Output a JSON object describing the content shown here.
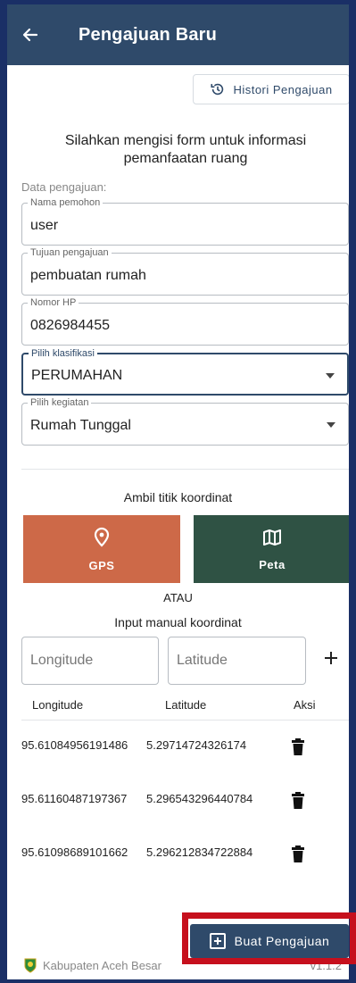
{
  "appbar": {
    "title": "Pengajuan Baru"
  },
  "histori_button": {
    "label": "Histori Pengajuan"
  },
  "intro": "Silahkan mengisi form untuk informasi pemanfaatan ruang",
  "section_label": "Data pengajuan:",
  "fields": [
    {
      "label": "Nama pemohon",
      "value": "user"
    },
    {
      "label": "Tujuan pengajuan",
      "value": "pembuatan rumah"
    },
    {
      "label": "Nomor HP",
      "value": "0826984455"
    },
    {
      "label": "Pilih klasifikasi",
      "value": "PERUMAHAN"
    },
    {
      "label": "Pilih kegiatan",
      "value": "Rumah Tunggal"
    }
  ],
  "coord": {
    "title": "Ambil titik koordinat",
    "gps_label": "GPS",
    "peta_label": "Peta",
    "atau": "ATAU",
    "manual_label": "Input manual koordinat",
    "longitude_placeholder": "Longitude",
    "latitude_placeholder": "Latitude"
  },
  "table": {
    "headers": [
      "Longitude",
      "Latitude",
      "Aksi"
    ],
    "rows": [
      {
        "longitude": "95.61084956191486",
        "latitude": "5.29714724326174"
      },
      {
        "longitude": "95.61160487197367",
        "latitude": "5.296543296440784"
      },
      {
        "longitude": "95.61098689101662",
        "latitude": "5.296212834722884"
      }
    ]
  },
  "create_button": {
    "label": "Buat Pengajuan"
  },
  "footer": {
    "org": "Kabupaten Aceh Besar",
    "version": "v1.1.2"
  },
  "colors": {
    "appbar": "#2f4a6a",
    "gps": "#cd6948",
    "peta": "#2f5244",
    "highlight": "#c6101d"
  },
  "icons": {
    "back": "arrow-left-icon",
    "history": "history-icon",
    "gps": "location-pin-icon",
    "peta": "map-icon",
    "add": "plus-icon",
    "delete": "trash-icon",
    "create": "add-box-icon"
  }
}
